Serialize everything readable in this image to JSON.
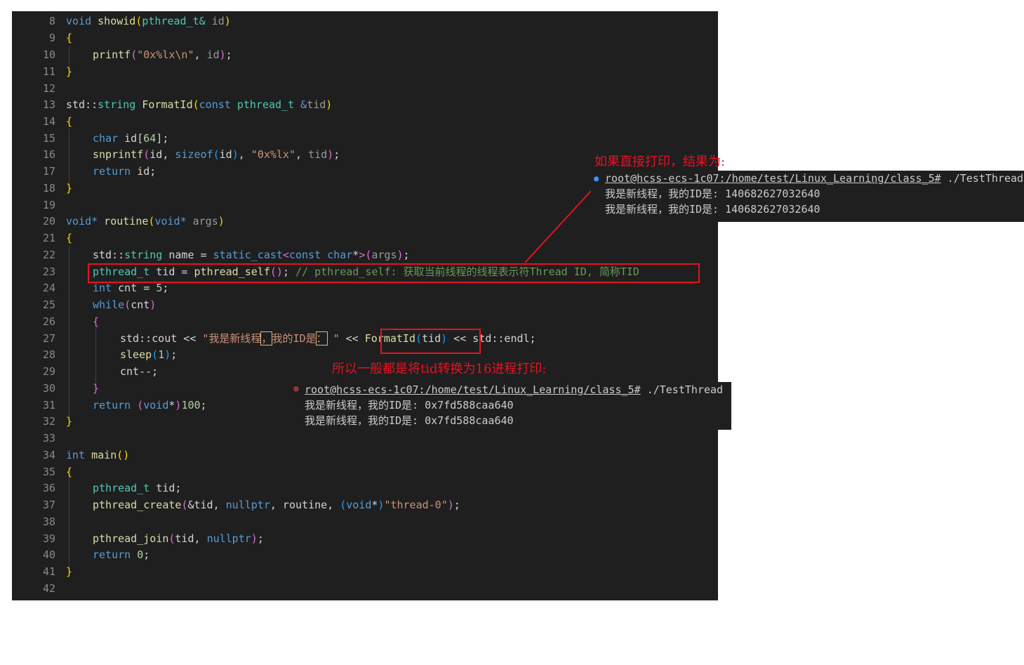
{
  "line_numbers": [
    "8",
    "9",
    "10",
    "11",
    "12",
    "13",
    "14",
    "15",
    "16",
    "17",
    "18",
    "19",
    "20",
    "21",
    "22",
    "23",
    "24",
    "25",
    "26",
    "27",
    "28",
    "29",
    "30",
    "31",
    "32",
    "33",
    "34",
    "35",
    "36",
    "37",
    "38",
    "39",
    "40",
    "41",
    "42"
  ],
  "code": {
    "l8": {
      "kw": "void",
      "fn": "showid",
      "lp": "(",
      "type": "pthread_t&",
      "param": " id",
      "rp": ")"
    },
    "l9": "{",
    "l10": {
      "fn": "printf",
      "lp": "(",
      "str": "\"0x%lx\\n\"",
      "rest": ", ",
      "arg": "id",
      "rp": ")",
      "semi": ";"
    },
    "l11": "}",
    "l13": {
      "ns": "std::",
      "type": "string",
      "fn": "FormatId",
      "lp": "(",
      "kw": "const",
      "type2": "pthread_t",
      "amp": "&",
      "param": "tid",
      "rp": ")"
    },
    "l14": "{",
    "l15": {
      "kw": "char",
      "rest": " id[",
      "num": "64",
      "end": "];"
    },
    "l16": {
      "fn": "snprintf",
      "lp": "(",
      "a": "id, ",
      "kw": "sizeof",
      "lp2": "(",
      "a2": "id",
      "rp2": ")",
      "c": ", ",
      "str": "\"0x%lx\"",
      "c2": ", ",
      "param": "tid",
      "rp": ")",
      "semi": ";"
    },
    "l17": {
      "kw": "return",
      "rest": " id;"
    },
    "l18": "}",
    "l20": {
      "kw": "void",
      "star": "*",
      "fn": " routine",
      "lp": "(",
      "kw2": "void",
      "star2": "*",
      "param": " args",
      "rp": ")"
    },
    "l21": "{",
    "l22": {
      "ns": "std::",
      "type": "string",
      "var": " name = ",
      "kw": "static_cast",
      "lt": "<",
      "kw2": "const",
      "kw3": " char",
      "star": "*",
      "gt": ">",
      "lp": "(",
      "param": "args",
      "rp": ")",
      "semi": ";"
    },
    "l23": {
      "type": "pthread_t",
      "rest": " tid = ",
      "fn": "pthread_self",
      "paren": "()",
      "semi": "; ",
      "comment": "// pthread_self: 获取当前线程的线程表示符Thread ID, 简称TID"
    },
    "l24": {
      "kw": "int",
      "rest": " cnt = ",
      "num": "5",
      "semi": ";"
    },
    "l25": {
      "kw": "while",
      "lp": "(",
      "arg": "cnt",
      "rp": ")"
    },
    "l26": "{",
    "l27": {
      "ns": "std::cout << ",
      "str1": "\"我是新线程",
      "h1": "，",
      "str2": "我的ID是",
      "h2": "：",
      "str3": " \"",
      "op": " << ",
      "fn": "FormatId",
      "lp": "(",
      "arg": "tid",
      "rp": ")",
      "rest": " << std::endl;"
    },
    "l28": {
      "fn": "sleep",
      "lp": "(",
      "num": "1",
      "rp": ")",
      "semi": ";"
    },
    "l29": "cnt--;",
    "l30": "}",
    "l31": {
      "kw": "return",
      "sp": " ",
      "lp": "(",
      "kw2": "void",
      "star": "*",
      "rp": ")",
      "num": "100",
      "semi": ";"
    },
    "l32": "}",
    "l34": {
      "kw": "int",
      "fn": " main",
      "paren": "()"
    },
    "l35": "{",
    "l36": {
      "type": "pthread_t",
      "rest": " tid;"
    },
    "l37": {
      "fn": "pthread_create",
      "lp": "(",
      "a": "&tid, ",
      "kw": "nullptr",
      "b": ", routine, ",
      "lp2": "(",
      "kw2": "void",
      "star": "*",
      "rp2": ")",
      "str": "\"thread-0\"",
      "rp": ")",
      "semi": ";"
    },
    "l39": {
      "fn": "pthread_join",
      "lp": "(",
      "a": "tid, ",
      "kw": "nullptr",
      "rp": ")",
      "semi": ";"
    },
    "l40": {
      "kw": "return",
      "sp": " ",
      "num": "0",
      "semi": ";"
    },
    "l41": "}"
  },
  "annotation_top": "如果直接打印，结果为:",
  "annotation_mid": "所以一般都是将tid转换为16进程打印:",
  "terminal_1": {
    "status_icon": "●",
    "prompt": "root@hcss-ecs-1c07:/home/test/Linux_Learning/class_5#",
    "command": " ./TestThread",
    "line1": "我是新线程，我的ID是: 140682627032640",
    "line2": "我是新线程，我的ID是: 140682627032640",
    "status_color": "#3794ff"
  },
  "terminal_2": {
    "status_icon": "⊗",
    "prompt": "root@hcss-ecs-1c07:/home/test/Linux_Learning/class_5#",
    "command": " ./TestThread",
    "line1": "我是新线程，我的ID是: 0x7fd588caa640",
    "line2": "我是新线程，我的ID是: 0x7fd588caa640",
    "status_color": "#f14c4c"
  },
  "colors": {
    "editor_bg": "#1f1f1f",
    "annotation": "#e81123",
    "keyword": "#569cd6",
    "type": "#4ec9b0",
    "function": "#dcdcaa",
    "string": "#ce9178",
    "number": "#b5cea8",
    "comment": "#6a9955"
  }
}
